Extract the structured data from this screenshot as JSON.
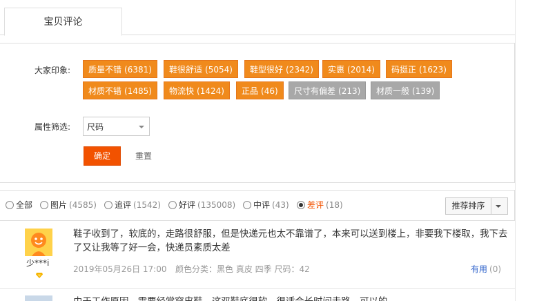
{
  "tabs": [
    {
      "label": "宝贝评论"
    }
  ],
  "impressions": {
    "label": "大家印象:",
    "tags": [
      {
        "text": "质量不错",
        "count": "(6381)",
        "sentiment": "positive"
      },
      {
        "text": "鞋很舒适",
        "count": "(5054)",
        "sentiment": "positive"
      },
      {
        "text": "鞋型很好",
        "count": "(2342)",
        "sentiment": "positive"
      },
      {
        "text": "实惠",
        "count": "(2014)",
        "sentiment": "positive"
      },
      {
        "text": "码挺正",
        "count": "(1623)",
        "sentiment": "positive"
      },
      {
        "text": "材质不错",
        "count": "(1485)",
        "sentiment": "positive"
      },
      {
        "text": "物流快",
        "count": "(1424)",
        "sentiment": "positive"
      },
      {
        "text": "正品",
        "count": "(46)",
        "sentiment": "positive"
      },
      {
        "text": "尺寸有偏差",
        "count": "(213)",
        "sentiment": "negative"
      },
      {
        "text": "材质一般",
        "count": "(139)",
        "sentiment": "negative"
      }
    ]
  },
  "attribute_filter": {
    "label": "属性筛选:",
    "selected": "尺码",
    "confirm_label": "确定",
    "reset_label": "重置"
  },
  "review_filter": {
    "options": [
      {
        "label": "全部",
        "count": "",
        "checked": false
      },
      {
        "label": "图片",
        "count": "(4585)",
        "checked": false
      },
      {
        "label": "追评",
        "count": "(1542)",
        "checked": false
      },
      {
        "label": "好评",
        "count": "(135008)",
        "checked": false
      },
      {
        "label": "中评",
        "count": "(43)",
        "checked": false
      },
      {
        "label": "差评",
        "count": "(18)",
        "checked": true
      }
    ],
    "sort_label": "推荐排序"
  },
  "reviews": [
    {
      "user": "少***i",
      "text": "鞋子收到了，软底的，走路很舒服，但是快递元也太不靠谱了，本来可以送到楼上，非要我下楼取，我下去了又让我等了好一会，快递员素质太差",
      "date": "2019年05月26日 17:00",
      "sku": "颜色分类：黑色 真皮 四季  尺码：42",
      "useful_label": "有用",
      "useful_count": "(0)"
    },
    {
      "text": "由于工作原因，需要经常穿皮鞋，这双鞋底很软，很适合长时间走路，可以的"
    }
  ],
  "colors": {
    "accent": "#f25200",
    "tag_positive": "#f08a1c",
    "tag_negative": "#a8a8a8",
    "link": "#3366cc"
  }
}
